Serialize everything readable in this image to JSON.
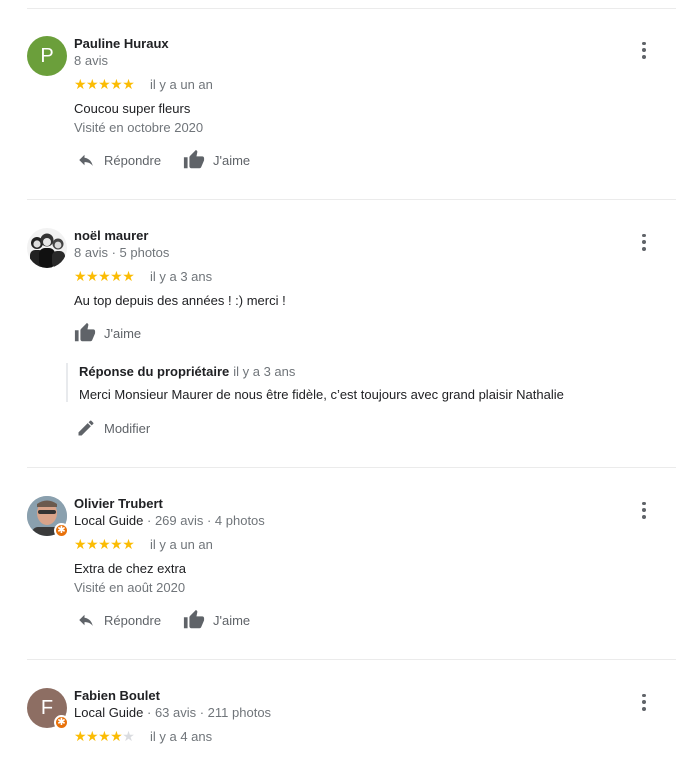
{
  "reviews": [
    {
      "avatar_letter": "P",
      "avatar_color": "#6b9f3b",
      "name": "Pauline Huraux",
      "meta": "8 avis",
      "rating": 5,
      "when": "il y a un an",
      "text": "Coucou super  fleurs",
      "visited": "Visité en octobre 2020",
      "reply_label": "Répondre",
      "like_label": "J'aime"
    },
    {
      "avatar_letter": "",
      "name": "noël maurer",
      "meta": "8 avis · 5 photos",
      "rating": 5,
      "when": "il y a 3 ans",
      "text": "Au top depuis des années ! :) merci !",
      "like_label": "J'aime",
      "owner_reply": {
        "title": "Réponse du propriétaire",
        "when": "il y a 3 ans",
        "text": "Merci Monsieur Maurer de nous être fidèle, c’est toujours avec grand plaisir Nathalie"
      },
      "edit_label": "Modifier"
    },
    {
      "name": "Olivier Trubert",
      "meta_guide": "Local Guide",
      "meta": " · 269 avis · 4 photos",
      "rating": 5,
      "when": "il y a un an",
      "text": "Extra de chez extra",
      "visited": "Visité en août 2020",
      "reply_label": "Répondre",
      "like_label": "J'aime"
    },
    {
      "avatar_letter": "F",
      "avatar_color": "#8d6e63",
      "name": "Fabien Boulet",
      "meta_guide": "Local Guide",
      "meta": " · 63 avis · 211 photos",
      "rating": 4,
      "when": "il y a 4 ans"
    }
  ],
  "colors": {
    "star": "#fbbc04",
    "muted": "#70757a",
    "badge": "#e8710a"
  },
  "icons": [
    "reply-icon",
    "thumb-up-icon",
    "pencil-icon",
    "more-vert-icon",
    "local-guide-badge-icon"
  ]
}
